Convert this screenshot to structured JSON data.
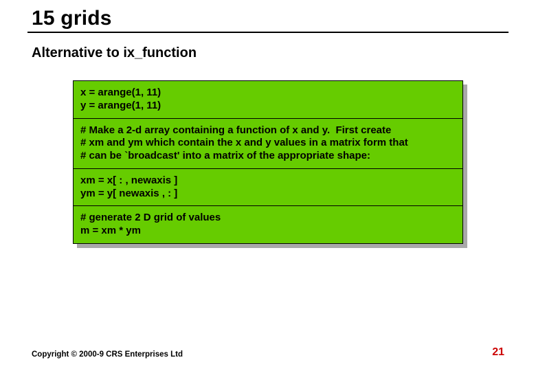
{
  "title": "15 grids",
  "subtitle": "Alternative to ix_function",
  "code": {
    "sections": [
      {
        "lines": [
          "x = arange(1, 11)",
          "y = arange(1, 11)"
        ]
      },
      {
        "lines": [
          "# Make a 2-d array containing a function of x and y.  First create",
          "# xm and ym which contain the x and y values in a matrix form that",
          "# can be `broadcast' into a matrix of the appropriate shape:"
        ]
      },
      {
        "lines": [
          "xm = x[ : , newaxis ]",
          "ym = y[ newaxis , : ]"
        ]
      },
      {
        "lines": [
          "# generate 2 D grid of values",
          "m = xm * ym"
        ]
      }
    ]
  },
  "footer": {
    "copyright": "Copyright © 2000-9 CRS Enterprises Ltd",
    "page": "21"
  }
}
